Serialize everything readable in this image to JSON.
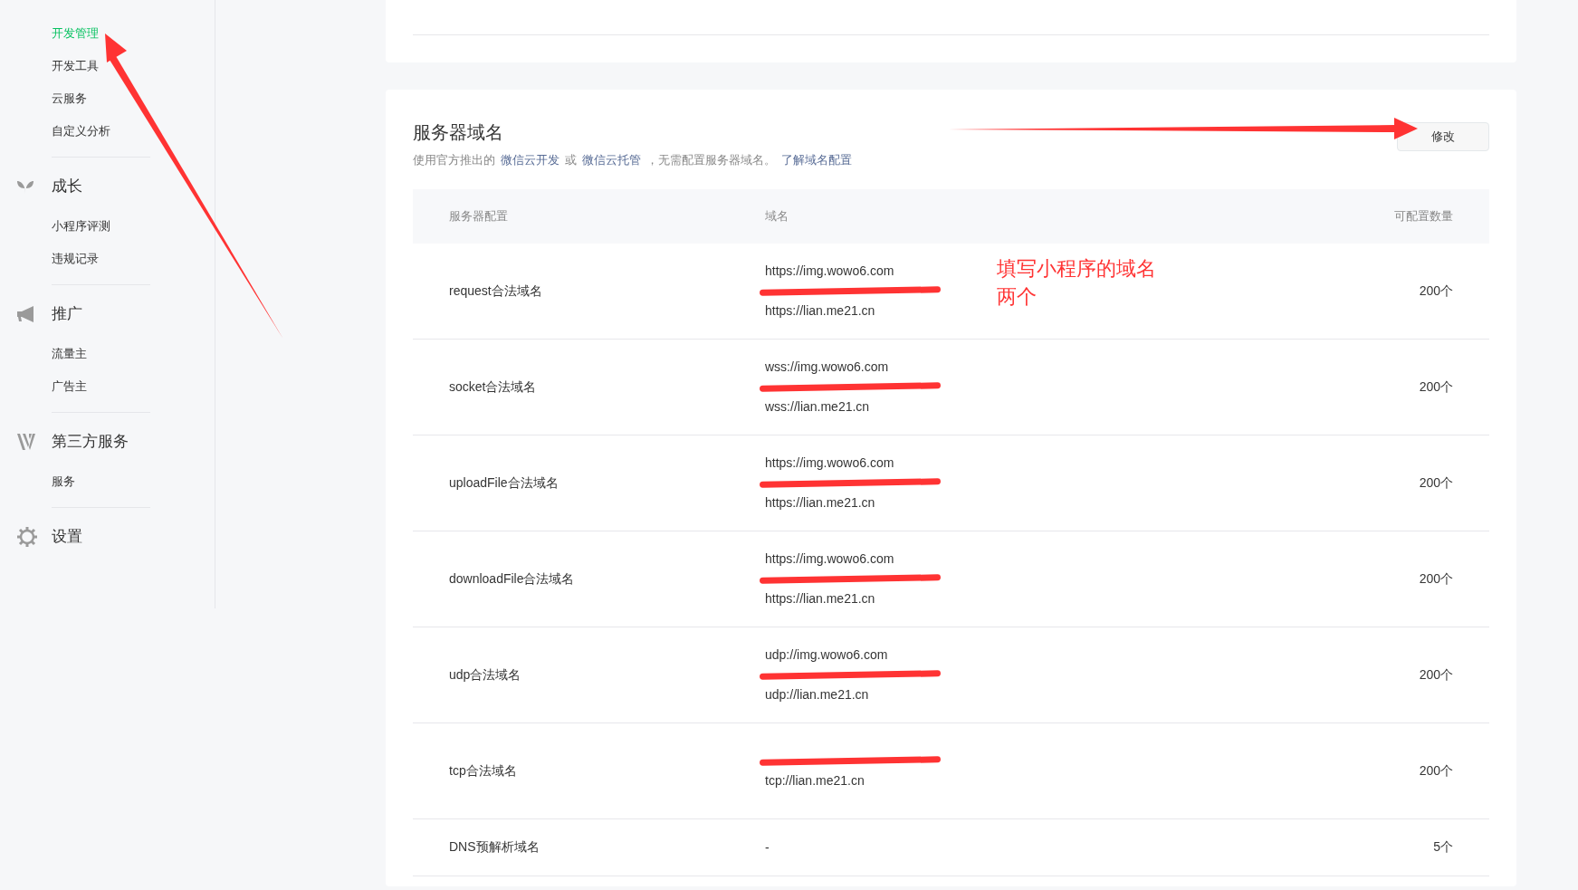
{
  "sidebar": {
    "items": [
      {
        "label": "开发管理",
        "selected": true
      },
      {
        "label": "开发工具",
        "selected": false
      },
      {
        "label": "云服务",
        "selected": false
      },
      {
        "label": "自定义分析",
        "selected": false
      }
    ],
    "groups": [
      {
        "kind": "sprout",
        "title": "成长",
        "items": [
          {
            "label": "小程序评测",
            "selected": false
          },
          {
            "label": "违规记录",
            "selected": false
          }
        ]
      },
      {
        "kind": "megaphone",
        "title": "推广",
        "items": [
          {
            "label": "流量主",
            "selected": false
          },
          {
            "label": "广告主",
            "selected": false
          }
        ]
      },
      {
        "kind": "third-party",
        "title": "第三方服务",
        "items": [
          {
            "label": "服务",
            "selected": false
          }
        ]
      },
      {
        "kind": "gear",
        "title": "设置"
      }
    ]
  },
  "server_domain": {
    "title": "服务器域名",
    "description_parts": [
      {
        "kind": "text",
        "text": "使用官方推出的"
      },
      {
        "kind": "link",
        "text": "微信云开发"
      },
      {
        "kind": "text",
        "text": "或"
      },
      {
        "kind": "link",
        "text": "微信云托管"
      },
      {
        "kind": "text",
        "text": "，无需配置服务器域名。"
      },
      {
        "kind": "link",
        "text": "了解域名配置"
      }
    ],
    "edit_button": "修改",
    "table": {
      "columns": [
        "服务器配置",
        "域名",
        "可配置数量"
      ],
      "rows": [
        {
          "name": "request合法域名",
          "domains": [
            {
              "kind": "text",
              "text": "https://img.wowo6.com"
            },
            {
              "kind": "redacted"
            },
            {
              "kind": "text",
              "text": "https://lian.me21.cn"
            }
          ],
          "count": "200个"
        },
        {
          "name": "socket合法域名",
          "domains": [
            {
              "kind": "text",
              "text": "wss://img.wowo6.com"
            },
            {
              "kind": "redacted"
            },
            {
              "kind": "text",
              "text": "wss://lian.me21.cn"
            }
          ],
          "count": "200个"
        },
        {
          "name": "uploadFile合法域名",
          "domains": [
            {
              "kind": "text",
              "text": "https://img.wowo6.com"
            },
            {
              "kind": "redacted"
            },
            {
              "kind": "text",
              "text": "https://lian.me21.cn"
            }
          ],
          "count": "200个"
        },
        {
          "name": "downloadFile合法域名",
          "domains": [
            {
              "kind": "text",
              "text": "https://img.wowo6.com"
            },
            {
              "kind": "redacted"
            },
            {
              "kind": "text",
              "text": "https://lian.me21.cn"
            }
          ],
          "count": "200个"
        },
        {
          "name": "udp合法域名",
          "domains": [
            {
              "kind": "text",
              "text": "udp://img.wowo6.com"
            },
            {
              "kind": "redacted"
            },
            {
              "kind": "text",
              "text": "udp://lian.me21.cn"
            }
          ],
          "count": "200个"
        },
        {
          "name": "tcp合法域名",
          "domains": [
            {
              "kind": "redacted"
            },
            {
              "kind": "text",
              "text": "tcp://lian.me21.cn"
            }
          ],
          "count": "200个"
        },
        {
          "name": "DNS预解析域名",
          "domains": [
            {
              "kind": "text",
              "text": "-"
            }
          ],
          "count": "5个"
        }
      ]
    }
  },
  "annotation": {
    "lines": [
      "填写小程序的域名",
      "两个"
    ]
  }
}
